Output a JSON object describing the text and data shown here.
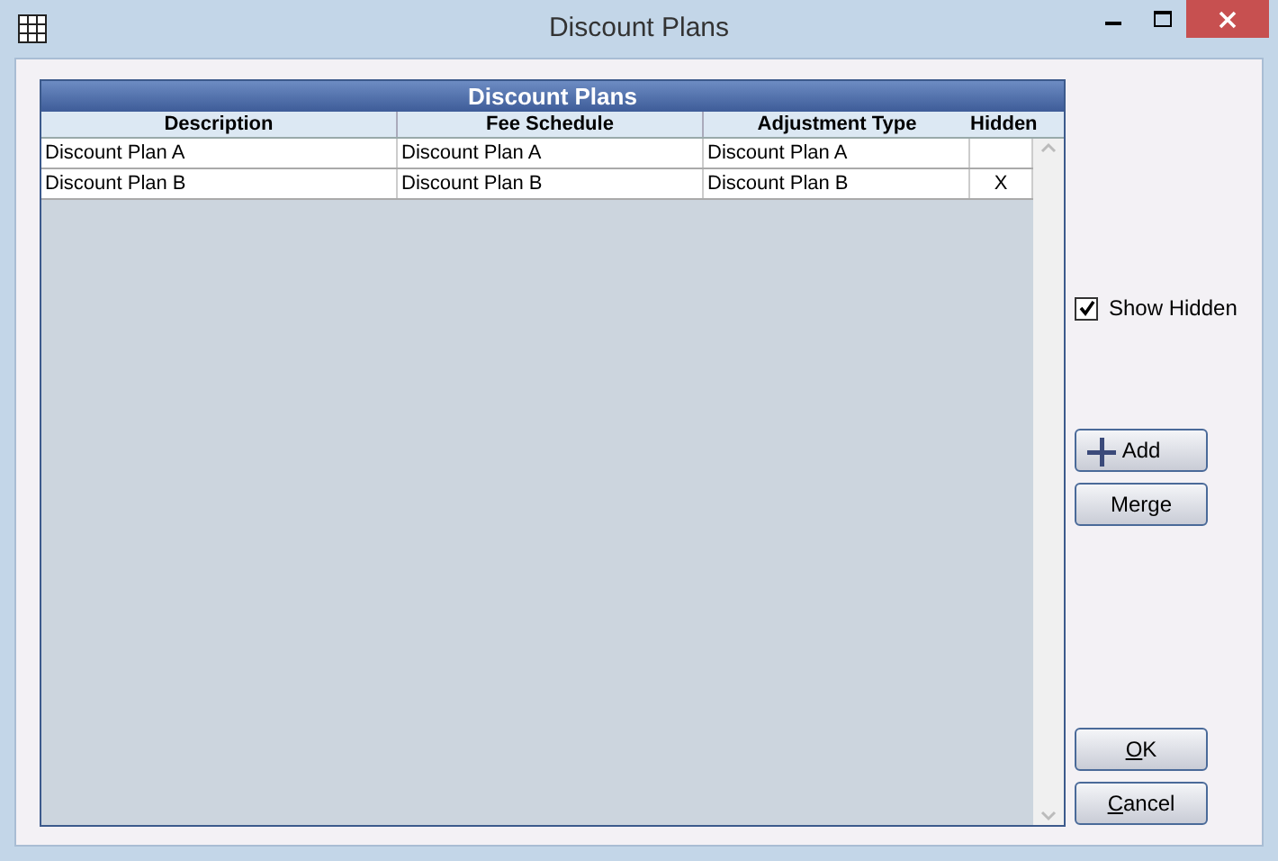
{
  "window": {
    "title": "Discount Plans"
  },
  "grid": {
    "title": "Discount Plans",
    "columns": [
      "Description",
      "Fee Schedule",
      "Adjustment Type",
      "Hidden"
    ],
    "rows": [
      {
        "cells": [
          "Discount Plan A",
          "Discount Plan A",
          "Discount Plan A",
          ""
        ]
      },
      {
        "cells": [
          "Discount Plan B",
          "Discount Plan B",
          "Discount Plan B",
          "X"
        ]
      }
    ]
  },
  "show_hidden": {
    "label": "Show Hidden",
    "checked": true
  },
  "buttons": [
    {
      "kind": "add",
      "label": "Add",
      "underline_first": false
    },
    {
      "kind": "plain",
      "label": "Merge",
      "underline_first": false
    },
    {
      "kind": "plain",
      "label": "OK",
      "underline_first": true
    },
    {
      "kind": "plain",
      "label": "Cancel",
      "underline_first": true
    }
  ]
}
